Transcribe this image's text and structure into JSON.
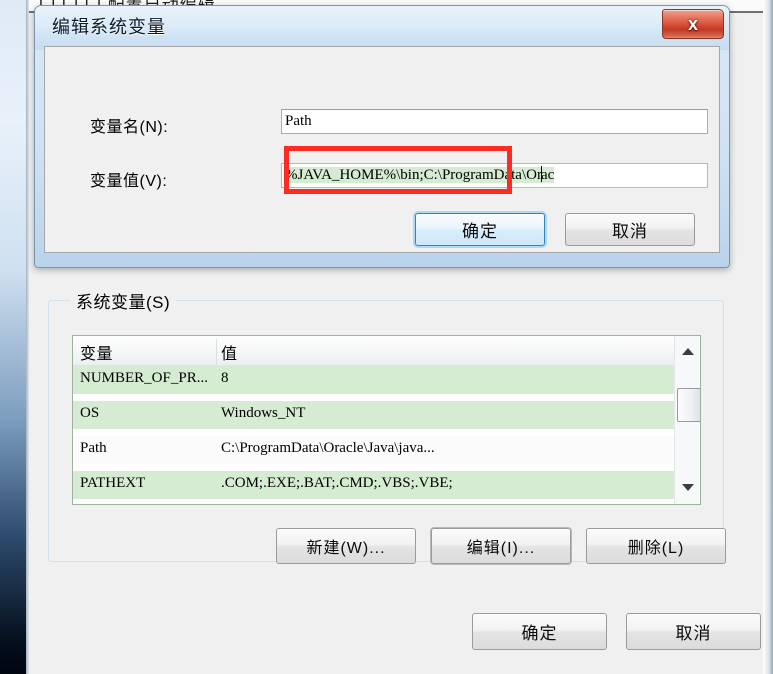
{
  "desktop": {
    "clipped_parent_text": "[ ] [ ] [ ]   配置自动编辑"
  },
  "edit_dialog": {
    "title": "编辑系统变量",
    "close_label": "x",
    "close_icon": "close-icon",
    "fields": [
      {
        "label": "变量名(N):",
        "value": "Path",
        "placeholder": ""
      },
      {
        "label": "变量值(V):",
        "value_before_caret": "%JAVA_HOME%\\bin;C:\\ProgramData\\Or",
        "value_after_caret": "ac",
        "placeholder": ""
      }
    ],
    "ok_label": "确定",
    "cancel_label": "取消",
    "annotation": {
      "color": "#fc2b23",
      "shape": "rectangle",
      "target": "变量值(V) 输入框"
    }
  },
  "system_variables": {
    "group_label": "系统变量(S)",
    "columns": [
      "变量",
      "值"
    ],
    "rows": [
      {
        "name": "NUMBER_OF_PR...",
        "value": "8",
        "selected": false
      },
      {
        "name": "OS",
        "value": "Windows_NT",
        "selected": false
      },
      {
        "name": "Path",
        "value": "C:\\ProgramData\\Oracle\\Java\\java...",
        "selected": true
      },
      {
        "name": "PATHEXT",
        "value": ".COM;.EXE;.BAT;.CMD;.VBS;.VBE;",
        "selected": false
      }
    ],
    "scrollbar": {
      "up_icon": "chevron-up-icon",
      "down_icon": "chevron-down-icon"
    },
    "buttons": {
      "new_label": "新建(W)...",
      "edit_label": "编辑(I)...",
      "delete_label": "删除(L)"
    }
  },
  "parent_dialog": {
    "ok_label": "确定",
    "cancel_label": "取消"
  },
  "colors": {
    "selection_green": "#d6ecd2",
    "annotation_red": "#fc2b23",
    "titlebar_blue": "#d9e8f7",
    "close_red": "#d9503a",
    "dialog_face": "#f0f0f0"
  }
}
